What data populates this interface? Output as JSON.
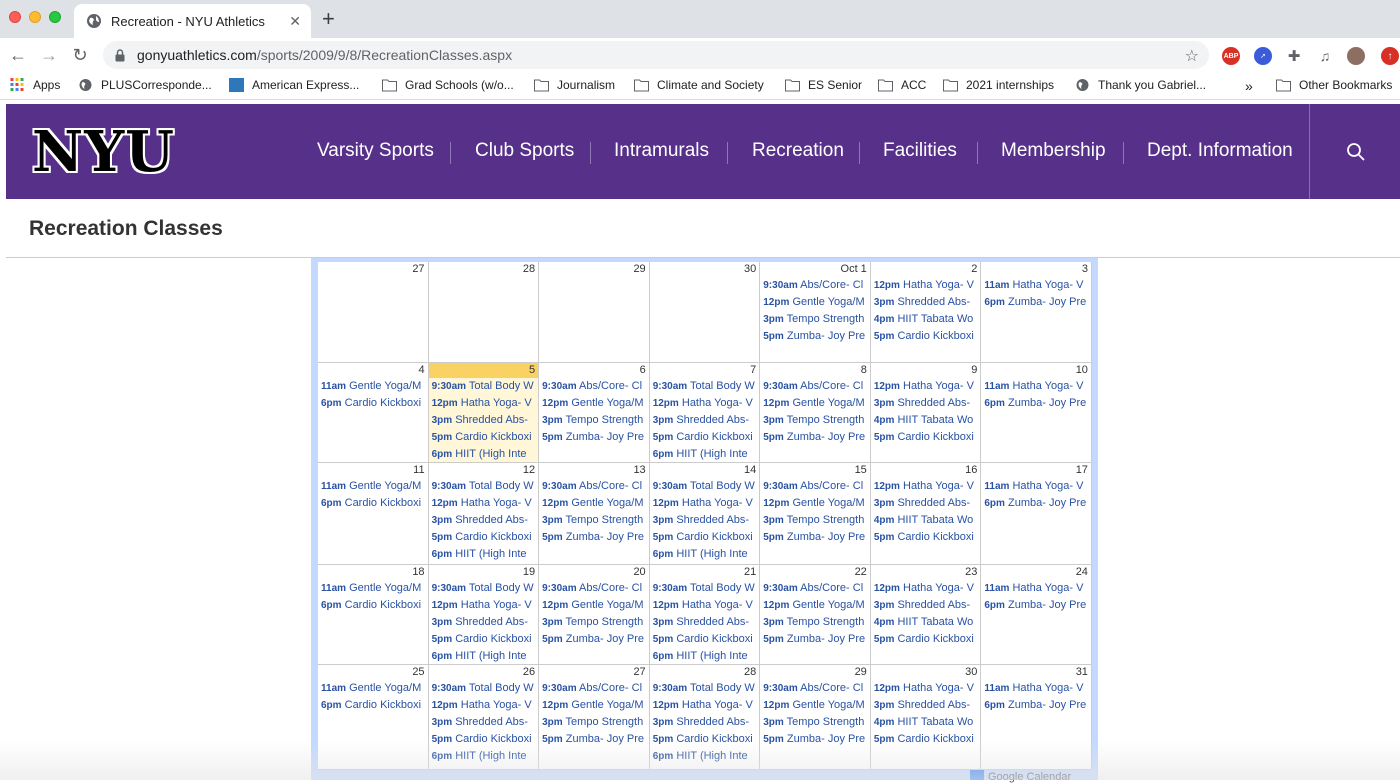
{
  "browser": {
    "tab_title": "Recreation - NYU Athletics",
    "url_host": "gonyuathletics.com",
    "url_path": "/sports/2009/9/8/RecreationClasses.aspx",
    "bookmarks": [
      "Apps",
      "PLUSCorresponde...",
      "American Express...",
      "Grad Schools (w/o...",
      "Journalism",
      "Climate and Society",
      "ES Senior",
      "ACC",
      "2021 internships",
      "Thank you Gabriel...",
      "Other Bookmarks"
    ],
    "more_bookmarks": "»",
    "abp_label": "ABP"
  },
  "site": {
    "logo": "NYU",
    "nav": [
      "Varsity Sports",
      "Club Sports",
      "Intramurals",
      "Recreation",
      "Facilities",
      "Membership",
      "Dept. Information"
    ],
    "brand_color": "#57308a"
  },
  "page": {
    "title": "Recreation Classes"
  },
  "calendar": {
    "weeks": [
      [
        {
          "day": "27",
          "events": []
        },
        {
          "day": "28",
          "events": []
        },
        {
          "day": "29",
          "events": []
        },
        {
          "day": "30",
          "events": []
        },
        {
          "day": "Oct 1",
          "events": [
            {
              "time": "9:30am",
              "title": "Abs/Core- Cl"
            },
            {
              "time": "12pm",
              "title": "Gentle Yoga/M"
            },
            {
              "time": "3pm",
              "title": "Tempo Strength"
            },
            {
              "time": "5pm",
              "title": "Zumba- Joy Pre"
            }
          ]
        },
        {
          "day": "2",
          "events": [
            {
              "time": "12pm",
              "title": "Hatha Yoga- V"
            },
            {
              "time": "3pm",
              "title": "Shredded Abs-"
            },
            {
              "time": "4pm",
              "title": "HIIT Tabata Wo"
            },
            {
              "time": "5pm",
              "title": "Cardio Kickboxi"
            }
          ]
        },
        {
          "day": "3",
          "events": [
            {
              "time": "11am",
              "title": "Hatha Yoga- V"
            },
            {
              "time": "6pm",
              "title": "Zumba- Joy Pre"
            }
          ]
        }
      ],
      [
        {
          "day": "4",
          "events": [
            {
              "time": "11am",
              "title": "Gentle Yoga/M"
            },
            {
              "time": "6pm",
              "title": "Cardio Kickboxi"
            }
          ]
        },
        {
          "day": "5",
          "today": true,
          "events": [
            {
              "time": "9:30am",
              "title": "Total Body W"
            },
            {
              "time": "12pm",
              "title": "Hatha Yoga- V"
            },
            {
              "time": "3pm",
              "title": "Shredded Abs-"
            },
            {
              "time": "5pm",
              "title": "Cardio Kickboxi"
            },
            {
              "time": "6pm",
              "title": "HIIT (High Inte"
            }
          ]
        },
        {
          "day": "6",
          "events": [
            {
              "time": "9:30am",
              "title": "Abs/Core- Cl"
            },
            {
              "time": "12pm",
              "title": "Gentle Yoga/M"
            },
            {
              "time": "3pm",
              "title": "Tempo Strength"
            },
            {
              "time": "5pm",
              "title": "Zumba- Joy Pre"
            }
          ]
        },
        {
          "day": "7",
          "events": [
            {
              "time": "9:30am",
              "title": "Total Body W"
            },
            {
              "time": "12pm",
              "title": "Hatha Yoga- V"
            },
            {
              "time": "3pm",
              "title": "Shredded Abs-"
            },
            {
              "time": "5pm",
              "title": "Cardio Kickboxi"
            },
            {
              "time": "6pm",
              "title": "HIIT (High Inte"
            }
          ]
        },
        {
          "day": "8",
          "events": [
            {
              "time": "9:30am",
              "title": "Abs/Core- Cl"
            },
            {
              "time": "12pm",
              "title": "Gentle Yoga/M"
            },
            {
              "time": "3pm",
              "title": "Tempo Strength"
            },
            {
              "time": "5pm",
              "title": "Zumba- Joy Pre"
            }
          ]
        },
        {
          "day": "9",
          "events": [
            {
              "time": "12pm",
              "title": "Hatha Yoga- V"
            },
            {
              "time": "3pm",
              "title": "Shredded Abs-"
            },
            {
              "time": "4pm",
              "title": "HIIT Tabata Wo"
            },
            {
              "time": "5pm",
              "title": "Cardio Kickboxi"
            }
          ]
        },
        {
          "day": "10",
          "events": [
            {
              "time": "11am",
              "title": "Hatha Yoga- V"
            },
            {
              "time": "6pm",
              "title": "Zumba- Joy Pre"
            }
          ]
        }
      ],
      [
        {
          "day": "11",
          "events": [
            {
              "time": "11am",
              "title": "Gentle Yoga/M"
            },
            {
              "time": "6pm",
              "title": "Cardio Kickboxi"
            }
          ]
        },
        {
          "day": "12",
          "events": [
            {
              "time": "9:30am",
              "title": "Total Body W"
            },
            {
              "time": "12pm",
              "title": "Hatha Yoga- V"
            },
            {
              "time": "3pm",
              "title": "Shredded Abs-"
            },
            {
              "time": "5pm",
              "title": "Cardio Kickboxi"
            },
            {
              "time": "6pm",
              "title": "HIIT (High Inte"
            }
          ]
        },
        {
          "day": "13",
          "events": [
            {
              "time": "9:30am",
              "title": "Abs/Core- Cl"
            },
            {
              "time": "12pm",
              "title": "Gentle Yoga/M"
            },
            {
              "time": "3pm",
              "title": "Tempo Strength"
            },
            {
              "time": "5pm",
              "title": "Zumba- Joy Pre"
            }
          ]
        },
        {
          "day": "14",
          "events": [
            {
              "time": "9:30am",
              "title": "Total Body W"
            },
            {
              "time": "12pm",
              "title": "Hatha Yoga- V"
            },
            {
              "time": "3pm",
              "title": "Shredded Abs-"
            },
            {
              "time": "5pm",
              "title": "Cardio Kickboxi"
            },
            {
              "time": "6pm",
              "title": "HIIT (High Inte"
            }
          ]
        },
        {
          "day": "15",
          "events": [
            {
              "time": "9:30am",
              "title": "Abs/Core- Cl"
            },
            {
              "time": "12pm",
              "title": "Gentle Yoga/M"
            },
            {
              "time": "3pm",
              "title": "Tempo Strength"
            },
            {
              "time": "5pm",
              "title": "Zumba- Joy Pre"
            }
          ]
        },
        {
          "day": "16",
          "events": [
            {
              "time": "12pm",
              "title": "Hatha Yoga- V"
            },
            {
              "time": "3pm",
              "title": "Shredded Abs-"
            },
            {
              "time": "4pm",
              "title": "HIIT Tabata Wo"
            },
            {
              "time": "5pm",
              "title": "Cardio Kickboxi"
            }
          ]
        },
        {
          "day": "17",
          "events": [
            {
              "time": "11am",
              "title": "Hatha Yoga- V"
            },
            {
              "time": "6pm",
              "title": "Zumba- Joy Pre"
            }
          ]
        }
      ],
      [
        {
          "day": "18",
          "events": [
            {
              "time": "11am",
              "title": "Gentle Yoga/M"
            },
            {
              "time": "6pm",
              "title": "Cardio Kickboxi"
            }
          ]
        },
        {
          "day": "19",
          "events": [
            {
              "time": "9:30am",
              "title": "Total Body W"
            },
            {
              "time": "12pm",
              "title": "Hatha Yoga- V"
            },
            {
              "time": "3pm",
              "title": "Shredded Abs-"
            },
            {
              "time": "5pm",
              "title": "Cardio Kickboxi"
            },
            {
              "time": "6pm",
              "title": "HIIT (High Inte"
            }
          ]
        },
        {
          "day": "20",
          "events": [
            {
              "time": "9:30am",
              "title": "Abs/Core- Cl"
            },
            {
              "time": "12pm",
              "title": "Gentle Yoga/M"
            },
            {
              "time": "3pm",
              "title": "Tempo Strength"
            },
            {
              "time": "5pm",
              "title": "Zumba- Joy Pre"
            }
          ]
        },
        {
          "day": "21",
          "events": [
            {
              "time": "9:30am",
              "title": "Total Body W"
            },
            {
              "time": "12pm",
              "title": "Hatha Yoga- V"
            },
            {
              "time": "3pm",
              "title": "Shredded Abs-"
            },
            {
              "time": "5pm",
              "title": "Cardio Kickboxi"
            },
            {
              "time": "6pm",
              "title": "HIIT (High Inte"
            }
          ]
        },
        {
          "day": "22",
          "events": [
            {
              "time": "9:30am",
              "title": "Abs/Core- Cl"
            },
            {
              "time": "12pm",
              "title": "Gentle Yoga/M"
            },
            {
              "time": "3pm",
              "title": "Tempo Strength"
            },
            {
              "time": "5pm",
              "title": "Zumba- Joy Pre"
            }
          ]
        },
        {
          "day": "23",
          "events": [
            {
              "time": "12pm",
              "title": "Hatha Yoga- V"
            },
            {
              "time": "3pm",
              "title": "Shredded Abs-"
            },
            {
              "time": "4pm",
              "title": "HIIT Tabata Wo"
            },
            {
              "time": "5pm",
              "title": "Cardio Kickboxi"
            }
          ]
        },
        {
          "day": "24",
          "events": [
            {
              "time": "11am",
              "title": "Hatha Yoga- V"
            },
            {
              "time": "6pm",
              "title": "Zumba- Joy Pre"
            }
          ]
        }
      ],
      [
        {
          "day": "25",
          "events": [
            {
              "time": "11am",
              "title": "Gentle Yoga/M"
            },
            {
              "time": "6pm",
              "title": "Cardio Kickboxi"
            }
          ]
        },
        {
          "day": "26",
          "events": [
            {
              "time": "9:30am",
              "title": "Total Body W"
            },
            {
              "time": "12pm",
              "title": "Hatha Yoga- V"
            },
            {
              "time": "3pm",
              "title": "Shredded Abs-"
            },
            {
              "time": "5pm",
              "title": "Cardio Kickboxi"
            },
            {
              "time": "6pm",
              "title": "HIIT (High Inte"
            }
          ]
        },
        {
          "day": "27",
          "events": [
            {
              "time": "9:30am",
              "title": "Abs/Core- Cl"
            },
            {
              "time": "12pm",
              "title": "Gentle Yoga/M"
            },
            {
              "time": "3pm",
              "title": "Tempo Strength"
            },
            {
              "time": "5pm",
              "title": "Zumba- Joy Pre"
            }
          ]
        },
        {
          "day": "28",
          "events": [
            {
              "time": "9:30am",
              "title": "Total Body W"
            },
            {
              "time": "12pm",
              "title": "Hatha Yoga- V"
            },
            {
              "time": "3pm",
              "title": "Shredded Abs-"
            },
            {
              "time": "5pm",
              "title": "Cardio Kickboxi"
            },
            {
              "time": "6pm",
              "title": "HIIT (High Inte"
            }
          ]
        },
        {
          "day": "29",
          "events": [
            {
              "time": "9:30am",
              "title": "Abs/Core- Cl"
            },
            {
              "time": "12pm",
              "title": "Gentle Yoga/M"
            },
            {
              "time": "3pm",
              "title": "Tempo Strength"
            },
            {
              "time": "5pm",
              "title": "Zumba- Joy Pre"
            }
          ]
        },
        {
          "day": "30",
          "events": [
            {
              "time": "12pm",
              "title": "Hatha Yoga- V"
            },
            {
              "time": "3pm",
              "title": "Shredded Abs-"
            },
            {
              "time": "4pm",
              "title": "HIIT Tabata Wo"
            },
            {
              "time": "5pm",
              "title": "Cardio Kickboxi"
            }
          ]
        },
        {
          "day": "31",
          "events": [
            {
              "time": "11am",
              "title": "Hatha Yoga- V"
            },
            {
              "time": "6pm",
              "title": "Zumba- Joy Pre"
            }
          ]
        }
      ]
    ],
    "footer_label": "Google Calendar"
  }
}
